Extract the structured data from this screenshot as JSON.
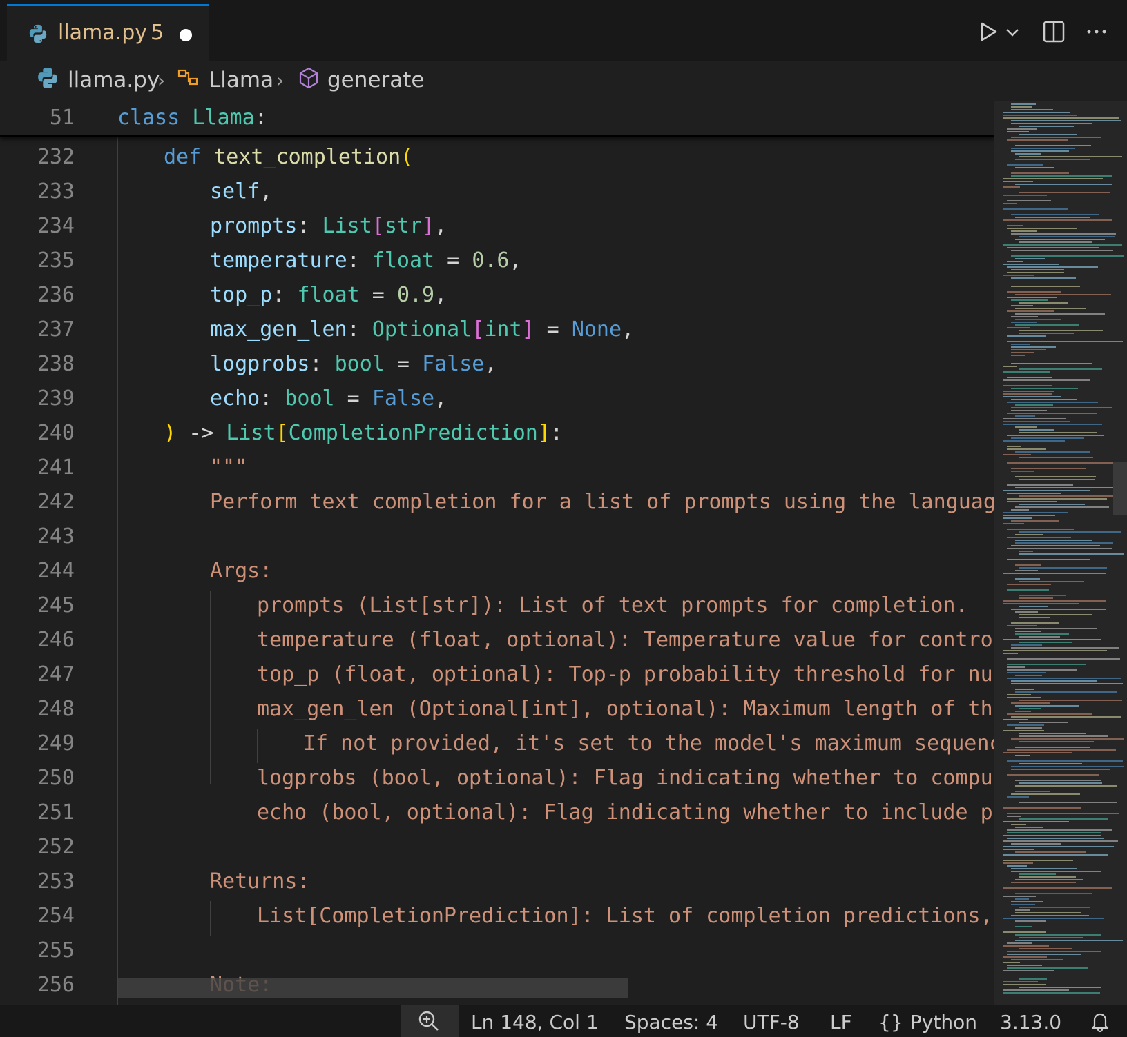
{
  "tab": {
    "filename": "llama.py",
    "problems_count": "5",
    "icon": "python-icon"
  },
  "toolbar": {
    "run_icon": "run-icon",
    "run_dropdown_icon": "chevron-down-icon",
    "split_icon": "split-editor-icon",
    "more_icon": "more-actions-icon"
  },
  "breadcrumb": {
    "file": "llama.py",
    "class": "Llama",
    "method": "generate"
  },
  "sticky": {
    "line_number": "51",
    "keyword": "class",
    "name": "Llama",
    "punct": ":"
  },
  "lines": {
    "232": {
      "num": "232",
      "kw": "def",
      "fn": "text_completion",
      "open": "("
    },
    "233": {
      "num": "233",
      "var": "self",
      "punct": ","
    },
    "234": {
      "num": "234",
      "var": "prompts",
      "colon": ": ",
      "type": "List",
      "b_open": "[",
      "inner": "str",
      "b_close": "]",
      "punct": ","
    },
    "235": {
      "num": "235",
      "var": "temperature",
      "colon": ": ",
      "type": "float",
      "eq": " = ",
      "value": "0.6",
      "punct": ","
    },
    "236": {
      "num": "236",
      "var": "top_p",
      "colon": ": ",
      "type": "float",
      "eq": " = ",
      "value": "0.9",
      "punct": ","
    },
    "237": {
      "num": "237",
      "var": "max_gen_len",
      "colon": ": ",
      "type": "Optional",
      "b_open": "[",
      "inner": "int",
      "b_close": "]",
      "eq": " = ",
      "value": "None",
      "punct": ","
    },
    "238": {
      "num": "238",
      "var": "logprobs",
      "colon": ": ",
      "type": "bool",
      "eq": " = ",
      "value": "False",
      "punct": ","
    },
    "239": {
      "num": "239",
      "var": "echo",
      "colon": ": ",
      "type": "bool",
      "eq": " = ",
      "value": "False",
      "punct": ","
    },
    "240": {
      "num": "240",
      "close": ")",
      "arrow": " -> ",
      "type": "List",
      "b_open": "[",
      "inner": "CompletionPrediction",
      "b_close": "]",
      "punct": ":"
    },
    "241": {
      "num": "241",
      "text": "\"\"\""
    },
    "242": {
      "num": "242",
      "text": "Perform text completion for a list of prompts using the language ger"
    },
    "243": {
      "num": "243",
      "text": ""
    },
    "244": {
      "num": "244",
      "text": "Args:"
    },
    "245": {
      "num": "245",
      "text": "prompts (List[str]): List of text prompts for completion."
    },
    "246": {
      "num": "246",
      "text": "temperature (float, optional): Temperature value for controlling"
    },
    "247": {
      "num": "247",
      "text": "top_p (float, optional): Top-p probability threshold for nucleus"
    },
    "248": {
      "num": "248",
      "text": "max_gen_len (Optional[int], optional): Maximum length of the ger"
    },
    "249": {
      "num": "249",
      "text": "If not provided, it's set to the model's maximum sequence le"
    },
    "250": {
      "num": "250",
      "text": "logprobs (bool, optional): Flag indicating whether to compute to"
    },
    "251": {
      "num": "251",
      "text": "echo (bool, optional): Flag indicating whether to include prompt"
    },
    "252": {
      "num": "252",
      "text": ""
    },
    "253": {
      "num": "253",
      "text": "Returns:"
    },
    "254": {
      "num": "254",
      "text": "List[CompletionPrediction]: List of completion predictions, each"
    },
    "255": {
      "num": "255",
      "text": ""
    },
    "256": {
      "num": "256",
      "text": "Note:"
    }
  },
  "status": {
    "zoom_icon": "zoom-icon",
    "position": "Ln 148, Col 1",
    "spaces": "Spaces: 4",
    "encoding": "UTF-8",
    "eol": "LF",
    "language": "Python",
    "version": "3.13.0",
    "bell_icon": "bell-icon"
  },
  "colors": {
    "background": "#1f1f1f",
    "keyword": "#569cd6",
    "class_name": "#4ec9b0",
    "function": "#dcdcaa",
    "variable": "#9cdcfe",
    "number": "#b5cea8",
    "string": "#ce9178",
    "bracket_gold": "#ffd700",
    "bracket_purple": "#da70d6",
    "modified": "#e2c08d",
    "active_tab_accent": "#0078d4"
  }
}
